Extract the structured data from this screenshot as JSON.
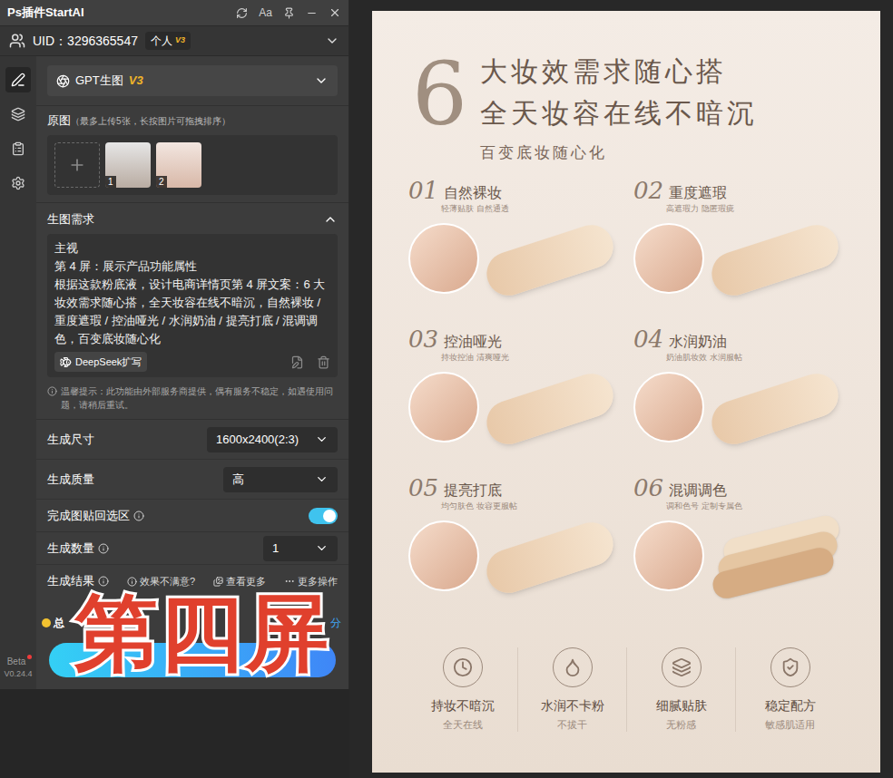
{
  "window": {
    "title": "Ps插件StartAI",
    "font_button": "Aa"
  },
  "user": {
    "uid": "UID：3296365547",
    "plan": "个人",
    "plan_version": "V3"
  },
  "sidebar": {
    "items": [
      {
        "kind": "edit",
        "selected": true
      },
      {
        "kind": "layers",
        "selected": false
      },
      {
        "kind": "clipboard",
        "selected": false
      },
      {
        "kind": "settings",
        "selected": false
      }
    ],
    "beta": "Beta",
    "version": "V0.24.4"
  },
  "model": {
    "label": "GPT生图",
    "version": "V3"
  },
  "source_images": {
    "label": "原图",
    "hint": "（最多上传5张，长按图片可拖拽排序）",
    "images": [
      {
        "index": "1"
      },
      {
        "index": "2"
      }
    ]
  },
  "prompt": {
    "label": "生图需求",
    "expanded": true,
    "lines": [
      "主视",
      "第 4 屏：展示产品功能属性",
      "根据这款粉底液，设计电商详情页第 4 屏文案：6 大妆效需求随心搭，全天妆容在线不暗沉，自然裸妆 / 重度遮瑕 / 控油哑光 / 水润奶油 / 提亮打底 / 混调调色，百变底妆随心化"
    ],
    "expand_button": "DeepSeek扩写"
  },
  "notice": "温馨提示：此功能由外部服务商提供，偶有服务不稳定，如遇使用问题，请稍后重试。",
  "settings": [
    {
      "label": "生成尺寸",
      "kind": "select",
      "info": false,
      "value": "1600x2400(2:3)"
    },
    {
      "label": "生成质量",
      "kind": "select",
      "info": false,
      "value": "高"
    },
    {
      "label": "完成图贴回选区",
      "kind": "toggle",
      "info": true,
      "on": true
    },
    {
      "label": "生成数量",
      "kind": "select",
      "info": true,
      "value": "1"
    }
  ],
  "result": {
    "label": "生成结果",
    "feedback": "效果不满意?",
    "view_more": "查看更多",
    "more_actions": "更多操作"
  },
  "cost_row": {
    "total": "总",
    "recharge": "分"
  },
  "overlay": "第四屏",
  "poster": {
    "number": "6",
    "headline": [
      "大妆效需求随心搭",
      "全天妆容在线不暗沉"
    ],
    "subtitle": "百变底妆随心化",
    "effects": [
      {
        "no": "01",
        "title": "自然裸妆",
        "desc": "轻薄贴肤 自然通透",
        "kind": "single"
      },
      {
        "no": "02",
        "title": "重度遮瑕",
        "desc": "高遮瑕力 隐匿瑕疵",
        "kind": "single"
      },
      {
        "no": "03",
        "title": "控油哑光",
        "desc": "持妆控油 清爽哑光",
        "kind": "single"
      },
      {
        "no": "04",
        "title": "水润奶油",
        "desc": "奶油肌妆效 水润服帖",
        "kind": "single"
      },
      {
        "no": "05",
        "title": "提亮打底",
        "desc": "均匀肤色 妆容更服帖",
        "kind": "single"
      },
      {
        "no": "06",
        "title": "混调调色",
        "desc": "调和色号 定制专属色",
        "kind": "mixed"
      }
    ],
    "features": [
      {
        "title": "持妆不暗沉",
        "desc": "全天在线",
        "kind": "clock"
      },
      {
        "title": "水润不卡粉",
        "desc": "不拔干",
        "kind": "droplet"
      },
      {
        "title": "细腻贴肤",
        "desc": "无粉感",
        "kind": "layers"
      },
      {
        "title": "稳定配方",
        "desc": "敏感肌适用",
        "kind": "shield"
      }
    ]
  }
}
